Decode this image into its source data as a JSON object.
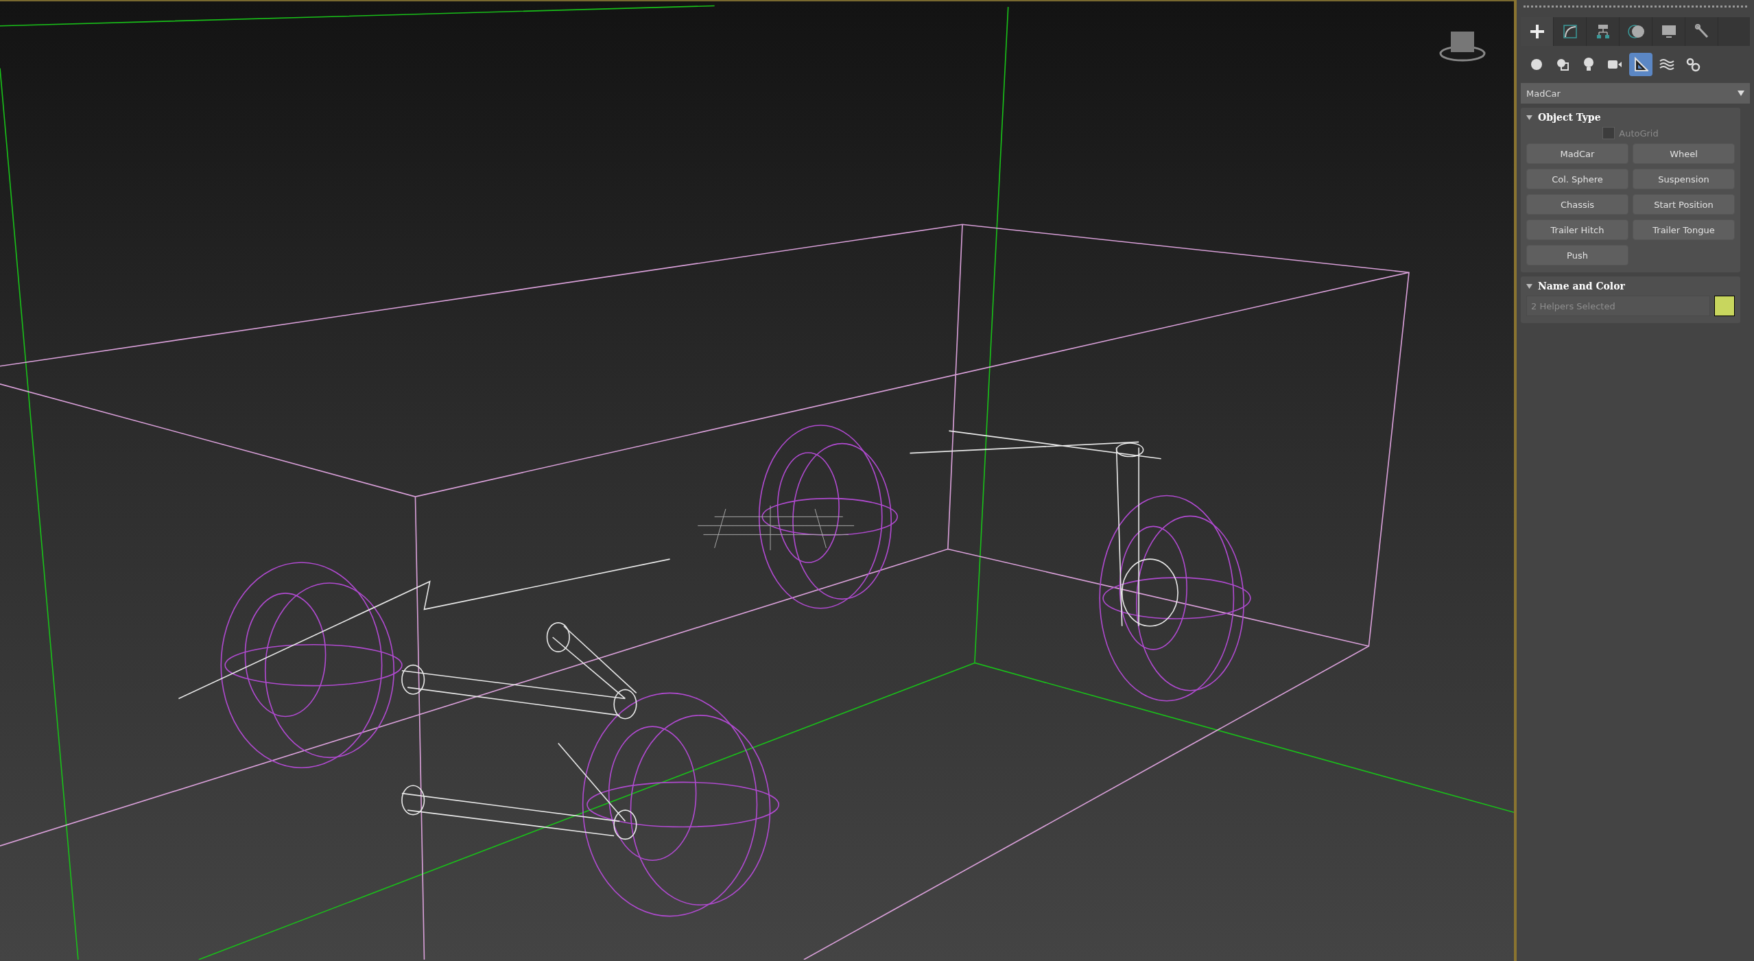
{
  "command_panel": {
    "tabs": [
      {
        "kind": "create",
        "selected": true
      },
      {
        "kind": "modify",
        "selected": false
      },
      {
        "kind": "hierarchy",
        "selected": false
      },
      {
        "kind": "motion",
        "selected": false
      },
      {
        "kind": "display",
        "selected": false
      },
      {
        "kind": "utilities",
        "selected": false
      }
    ],
    "categories": [
      {
        "kind": "geometry",
        "selected": false
      },
      {
        "kind": "shapes",
        "selected": false
      },
      {
        "kind": "lights",
        "selected": false
      },
      {
        "kind": "cameras",
        "selected": false
      },
      {
        "kind": "helpers",
        "selected": true
      },
      {
        "kind": "spacewarps",
        "selected": false
      },
      {
        "kind": "systems",
        "selected": false
      }
    ],
    "dropdown": {
      "value": "MadCar"
    },
    "object_type": {
      "title": "Object Type",
      "expanded": true,
      "autogrid": {
        "label": "AutoGrid",
        "checked": false,
        "disabled": true
      },
      "buttons": [
        "MadCar",
        "Wheel",
        "Col. Sphere",
        "Suspension",
        "Chassis",
        "Start Position",
        "Trailer Hitch",
        "Trailer Tongue",
        "Push"
      ]
    },
    "name_and_color": {
      "title": "Name and Color",
      "expanded": true,
      "name": {
        "value": "2 Helpers Selected"
      },
      "color": "#c8d65e"
    }
  }
}
